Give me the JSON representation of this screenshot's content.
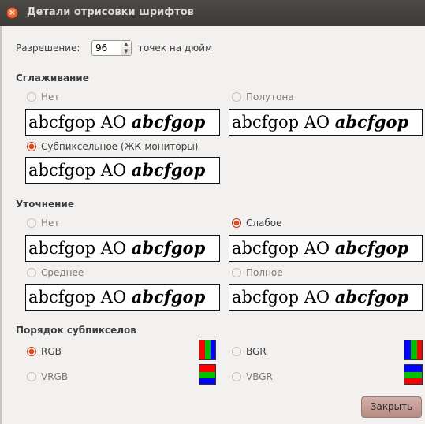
{
  "window": {
    "title": "Детали отрисовки шрифтов"
  },
  "resolution": {
    "label": "Разрешение:",
    "value": "96",
    "unit": "точек на дюйм"
  },
  "sample_text": {
    "normal": "abcfgop AO ",
    "italic": "abcfgop"
  },
  "antialiasing": {
    "heading": "Сглаживание",
    "options": [
      {
        "label": "Нет",
        "selected": false
      },
      {
        "label": "Полутона",
        "selected": false
      },
      {
        "label": "Субпиксельное (ЖК-мониторы)",
        "selected": true
      }
    ]
  },
  "hinting": {
    "heading": "Уточнение",
    "options": [
      {
        "label": "Нет",
        "selected": false
      },
      {
        "label": "Слабое",
        "selected": true
      },
      {
        "label": "Среднее",
        "selected": false
      },
      {
        "label": "Полное",
        "selected": false
      }
    ]
  },
  "subpixel_order": {
    "heading": "Порядок субпикселов",
    "options": [
      {
        "label": "RGB",
        "selected": true,
        "icon": "rgb-order-icon"
      },
      {
        "label": "BGR",
        "selected": false,
        "icon": "bgr-order-icon"
      },
      {
        "label": "VRGB",
        "selected": false,
        "icon": "vrgb-order-icon"
      },
      {
        "label": "VBGR",
        "selected": false,
        "icon": "vbgr-order-icon"
      }
    ]
  },
  "colors": {
    "red": "#ff0000",
    "green": "#00c000",
    "blue": "#0000ff",
    "accent": "#df4a16"
  },
  "footer": {
    "close_label": "Закрыть"
  }
}
